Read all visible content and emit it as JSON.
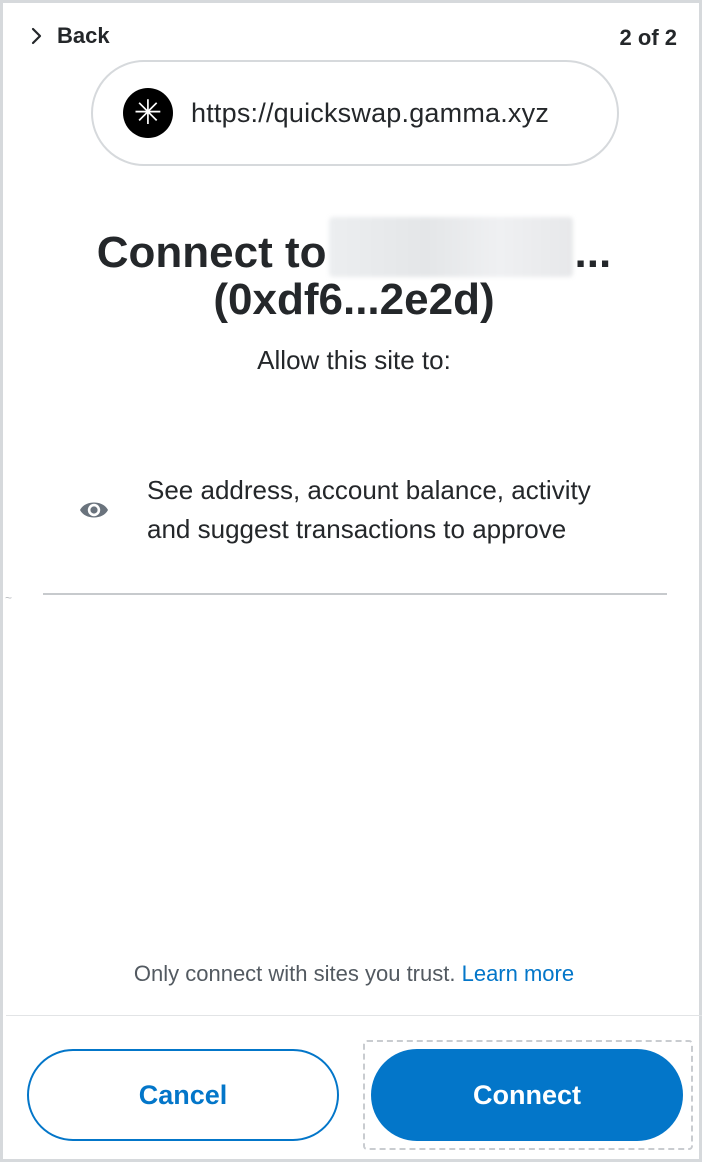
{
  "header": {
    "back_label": "Back",
    "page_count": "2 of 2"
  },
  "site": {
    "icon_glyph": "✳",
    "url": "https://quickswap.gamma.xyz"
  },
  "title": {
    "prefix": "Connect to",
    "ellipsis": "...",
    "account_address": "(0xdf6...2e2d)"
  },
  "allow_text": "Allow this site to:",
  "permission": {
    "icon": "eye-icon",
    "text_line1": "See address, account balance, activity",
    "text_line2": "and suggest transactions to approve"
  },
  "notice": {
    "text": "Only connect with sites you trust.",
    "link": "Learn more"
  },
  "buttons": {
    "cancel": "Cancel",
    "connect": "Connect"
  },
  "colors": {
    "primary": "#0376c9",
    "text": "#24272a",
    "muted": "#535a61",
    "border": "#d6d9dc"
  }
}
